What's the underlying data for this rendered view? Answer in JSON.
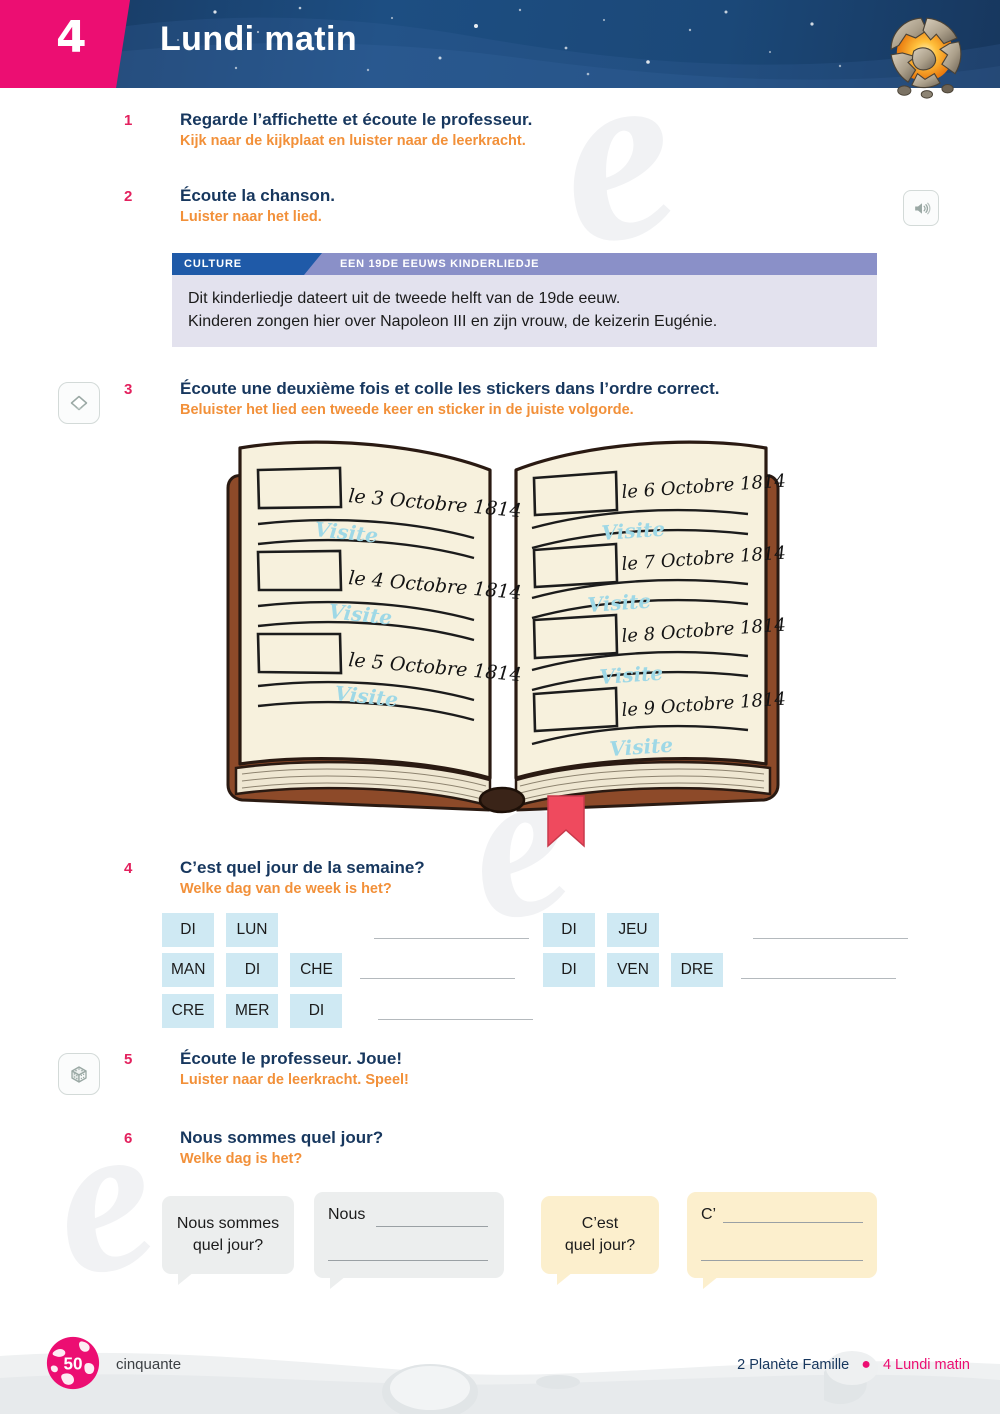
{
  "header": {
    "unit_number": "4",
    "title": "Lundi matin",
    "globe_icon": "cracked-planet-icon",
    "colors": {
      "pink": "#ec0e72",
      "navy": "#17375e"
    }
  },
  "audio_icon": "speaker-icon",
  "exercises": [
    {
      "number": "1",
      "fr": "Regarde l’affichette et écoute le professeur.",
      "nl": "Kijk naar de kijkplaat en luister naar de leerkracht."
    },
    {
      "number": "2",
      "fr": "Écoute la chanson.",
      "nl": "Luister naar het lied."
    },
    {
      "number": "3",
      "fr": "Écoute une deuxième fois et colle les stickers dans l’ordre correct.",
      "nl": "Beluister het lied een tweede keer en sticker in de juiste volgorde.",
      "icon": "sticker-icon"
    },
    {
      "number": "4",
      "fr": "C’est quel jour de la semaine?",
      "nl": "Welke dag van de week is het?"
    },
    {
      "number": "5",
      "fr": "Écoute le professeur. Joue!",
      "nl": "Luister naar de leerkracht. Speel!",
      "icon": "dice-icon"
    },
    {
      "number": "6",
      "fr": "Nous sommes quel jour?",
      "nl": "Welke dag is het?"
    }
  ],
  "culture": {
    "tab_label": "CULTURE",
    "heading": "EEN 19DE EEUWS KINDERLIEDJE",
    "line1": "Dit kinderliedje dateert uit de tweede helft van de 19de eeuw.",
    "line2": "Kinderen zongen hier over Napoleon III en zijn vrouw, de keizerin Eugénie."
  },
  "book": {
    "left_page": [
      {
        "date": "le 3 Octobre 1814",
        "note": "Visite"
      },
      {
        "date": "le 4 Octobre 1814",
        "note": "Visite"
      },
      {
        "date": "le 5 Octobre 1814",
        "note": "Visite"
      }
    ],
    "right_page": [
      {
        "date": "le 6 Octobre 1814",
        "note": "Visite"
      },
      {
        "date": "le 7 Octobre 1814",
        "note": "Visite"
      },
      {
        "date": "le 8 Octobre 1814",
        "note": "Visite"
      },
      {
        "date": "le 9 Octobre 1814",
        "note": "Visite"
      }
    ],
    "cover_color": "#8d4a29",
    "page_color": "#f7f1dd",
    "ribbon_color": "#ef4a5e",
    "note_color": "#9ed8e6"
  },
  "ex4": {
    "left_rows": [
      [
        "DI",
        "LUN"
      ],
      [
        "MAN",
        "DI",
        "CHE"
      ],
      [
        "CRE",
        "MER",
        "DI"
      ]
    ],
    "right_rows": [
      [
        "DI",
        "JEU"
      ],
      [
        "DI",
        "VEN",
        "DRE"
      ]
    ],
    "tile_color": "#cfe9f3"
  },
  "ex6": {
    "bubble1": {
      "line1": "Nous sommes",
      "line2": "quel jour?",
      "color": "#eceeee"
    },
    "bubble2": {
      "prefix": "Nous",
      "color": "#eceeee"
    },
    "bubble3": {
      "line1": "C’est",
      "line2": "quel jour?",
      "color": "#fcefcd"
    },
    "bubble4": {
      "prefix": "C’",
      "color": "#fcefcd"
    }
  },
  "footer": {
    "page_number": "50",
    "page_word": "cinquante",
    "unit_ref": "2  Planète Famille",
    "separator": "●",
    "lesson_ref": "4  Lundi matin"
  },
  "watermark": {
    "text": "e"
  }
}
